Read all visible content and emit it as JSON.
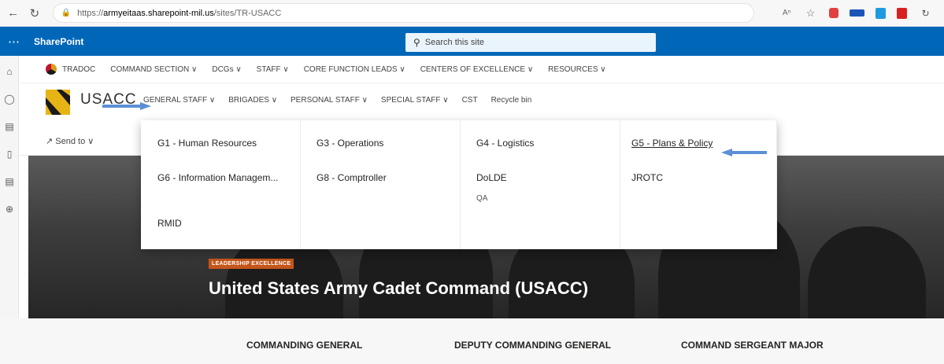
{
  "browser": {
    "back_icon": "back-arrow-icon",
    "refresh_icon": "refresh-icon",
    "url_prefix": "https://",
    "url_host": "armyeitaas.sharepoint-mil.us",
    "url_path": "/sites/TR-USACC",
    "reader_label": "A̅"
  },
  "suite": {
    "brand": "SharePoint",
    "search_placeholder": "Search this site"
  },
  "hub_nav": {
    "items": [
      "TRADOC",
      "COMMAND SECTION ∨",
      "DCGs ∨",
      "STAFF ∨",
      "CORE FUNCTION LEADS ∨",
      "CENTERS OF EXCELLENCE ∨",
      "RESOURCES ∨"
    ]
  },
  "site": {
    "title": "USACC",
    "nav": [
      "GENERAL STAFF ∨",
      "BRIGADES ∨",
      "PERSONAL STAFF ∨",
      "SPECIAL STAFF ∨",
      "CST",
      "Recycle bin"
    ]
  },
  "command_bar": {
    "send_to": "Send to ∨"
  },
  "mega_menu": {
    "col1": [
      "G1 - Human Resources",
      "G6 - Information Managem...",
      "RMID"
    ],
    "col2": [
      "G3 - Operations",
      "G8 - Comptroller"
    ],
    "col3": [
      "G4 - Logistics",
      "DoLDE"
    ],
    "col3_sub": "QA",
    "col4": [
      "G5 - Plans & Policy",
      "JROTC"
    ]
  },
  "hero": {
    "tag": "LEADERSHIP EXCELLENCE",
    "title": "United States Army Cadet Command (USACC)"
  },
  "leaders": [
    "COMMANDING GENERAL",
    "DEPUTY COMMANDING GENERAL",
    "COMMAND SERGEANT MAJOR"
  ],
  "colors": {
    "suite_blue": "#0067b8",
    "arrow_blue": "#5b8fd6",
    "hero_tag": "#c3561a"
  }
}
